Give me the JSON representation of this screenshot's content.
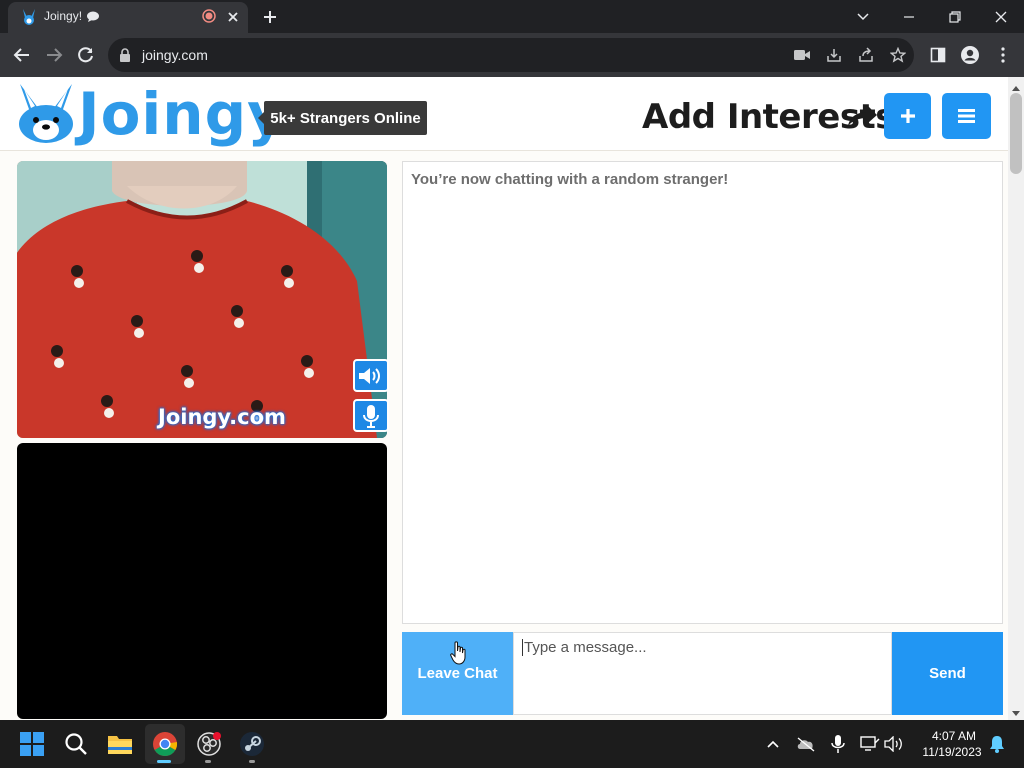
{
  "browser": {
    "tab_title": "Joingy!",
    "url": "joingy.com"
  },
  "site": {
    "logo_text": "Joingy",
    "online_badge": "5k+ Strangers Online",
    "add_interests": "Add Interests",
    "watermark": "Joingy.com"
  },
  "chat": {
    "status": "You’re now chatting with a random stranger!",
    "leave_label": "Leave Chat",
    "input_placeholder": "Type a message...",
    "send_label": "Send"
  },
  "taskbar": {
    "time": "4:07 AM",
    "date": "11/19/2023"
  },
  "colors": {
    "brand_blue": "#2196f3",
    "leave_blue": "#4fb0f8",
    "browser_dark": "#202124"
  }
}
